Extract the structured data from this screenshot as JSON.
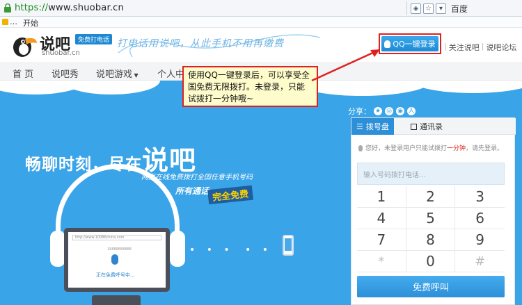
{
  "browser": {
    "url_protocol": "https://",
    "url_host": "www.shuobar.cn",
    "search_engine": "百度",
    "bookmark": "开始"
  },
  "header": {
    "logo_text": "说吧",
    "logo_domain": "shuobar.cn",
    "logo_badge": "免费打电话",
    "slogan": "打电话用说吧，从此手机不用再缴费",
    "qq_login": "QQ一键登录",
    "links": [
      "关注说吧",
      "说吧论坛"
    ]
  },
  "nav": {
    "items": [
      "首 页",
      "说吧秀",
      "说吧游戏",
      "个人中"
    ]
  },
  "hero": {
    "title_pre": "畅聊时刻，尽在",
    "title_brand": "说吧",
    "subtitle": "网页在线免费拨打全国任意手机号码",
    "free_pre": "所有通话",
    "free_badge": "完全免费",
    "monitor_addr": "http://www.10086china.com",
    "monitor_number": "18888888888",
    "monitor_status": "正在免费呼号中..."
  },
  "share": {
    "label": "分享："
  },
  "dialer": {
    "tabs": [
      "拨号盘",
      "通讯录"
    ],
    "notice_pre": "您好，未登录用户只能试拨打",
    "notice_red": "一分钟",
    "notice_post": "，请先登录。",
    "input_placeholder": "输入号码拨打电话...",
    "keys": [
      "1",
      "2",
      "3",
      "4",
      "5",
      "6",
      "7",
      "8",
      "9",
      "*",
      "0",
      "#"
    ],
    "call_button": "免费呼叫"
  },
  "annotation": {
    "text": "使用QQ一键登录后，可以享受全国免费无限拨打。未登录，只能试拨打一分钟哦~"
  },
  "colors": {
    "brand_blue": "#3aa4e8",
    "button_blue": "#2d8fd8",
    "annotation_border": "#e02020",
    "annotation_bg": "#fffccc",
    "free_text": "#ffd200"
  }
}
